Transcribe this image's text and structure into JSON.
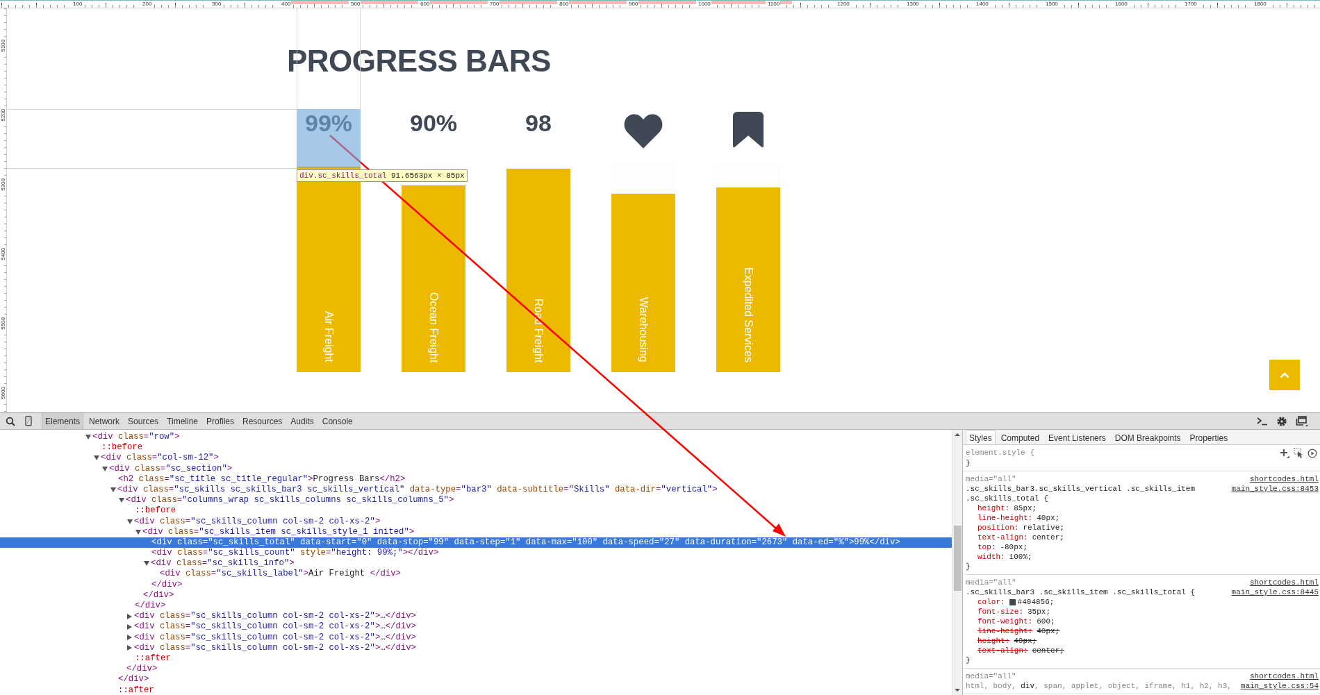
{
  "ruler": {
    "top_labels": [
      "100",
      "200",
      "300",
      "400",
      "500",
      "600",
      "700",
      "800",
      "900",
      "1000",
      "1100",
      "1200",
      "1300",
      "1400",
      "1500",
      "1600",
      "1700",
      "1800"
    ],
    "left_labels": [
      "5100",
      "5200",
      "5300",
      "5400",
      "5500",
      "5600"
    ]
  },
  "page": {
    "title": "PROGRESS BARS",
    "skills": [
      {
        "kind": "total",
        "total": "99%",
        "label": "Air Freight",
        "level": 0.99,
        "inspected": true
      },
      {
        "kind": "total",
        "total": "90%",
        "label": "Ocean Freight",
        "level": 0.9,
        "inspected": false
      },
      {
        "kind": "total",
        "total": "98",
        "label": "Road Freight",
        "level": 0.98,
        "inspected": false
      },
      {
        "kind": "heart",
        "label": "Warehousing",
        "level": 0.86,
        "inspected": false
      },
      {
        "kind": "bookmark",
        "label": "Expedited Services",
        "level": 0.89,
        "inspected": false
      }
    ],
    "inspector_tooltip": {
      "selector": "div.sc_skills_total",
      "size": "91.6563px × 85px"
    }
  },
  "devtools": {
    "tabs": [
      {
        "label": "Elements",
        "selected": true
      },
      {
        "label": "Network",
        "selected": false
      },
      {
        "label": "Sources",
        "selected": false
      },
      {
        "label": "Timeline",
        "selected": false
      },
      {
        "label": "Profiles",
        "selected": false
      },
      {
        "label": "Resources",
        "selected": false
      },
      {
        "label": "Audits",
        "selected": false
      },
      {
        "label": "Console",
        "selected": false
      }
    ],
    "elements_tree": [
      {
        "line": "<div class=\"row\">",
        "expanded": true,
        "selected": false,
        "children": [
          {
            "line": "::before",
            "selected": false
          },
          {
            "line": "<div class=\"col-sm-12\">",
            "expanded": true,
            "selected": false,
            "children": [
              {
                "line": "<div class=\"sc_section\">",
                "expanded": true,
                "selected": false,
                "children": [
                  {
                    "line": "<h2 class=\"sc_title sc_title_regular\">Progress Bars</h2>",
                    "selected": false
                  },
                  {
                    "line": "<div class=\"sc_skills sc_skills_bar3 sc_skills_vertical\" data-type=\"bar3\" data-subtitle=\"Skills\" data-dir=\"vertical\">",
                    "expanded": true,
                    "selected": false,
                    "close": "</div>",
                    "children": [
                      {
                        "line": "<div class=\"columns_wrap sc_skills_columns sc_skills_columns_5\">",
                        "expanded": true,
                        "selected": false,
                        "close": "</div>",
                        "children": [
                          {
                            "line": "::before",
                            "selected": false
                          },
                          {
                            "line": "<div class=\"sc_skills_column col-sm-2 col-xs-2\">",
                            "expanded": true,
                            "selected": false,
                            "close": "</div>",
                            "children": [
                              {
                                "line": "<div class=\"sc_skills_item sc_skills_style_1 inited\">",
                                "expanded": true,
                                "selected": false,
                                "close": "</div>",
                                "children": [
                                  {
                                    "line": "<div class=\"sc_skills_total\" data-start=\"0\" data-stop=\"99\" data-step=\"1\" data-max=\"100\" data-speed=\"27\" data-duration=\"2673\" data-ed=\"%\">99%</div>",
                                    "selected": true
                                  },
                                  {
                                    "line": "<div class=\"sc_skills_count\" style=\"height: 99%;\"></div>",
                                    "selected": false
                                  },
                                  {
                                    "line": "<div class=\"sc_skills_info\">",
                                    "expanded": true,
                                    "selected": false,
                                    "close": "</div>",
                                    "children": [
                                      {
                                        "line": "<div class=\"sc_skills_label\">Air Freight </div>",
                                        "selected": false
                                      }
                                    ]
                                  }
                                ]
                              }
                            ]
                          },
                          {
                            "line": "<div class=\"sc_skills_column col-sm-2 col-xs-2\">…</div>",
                            "expanded": false,
                            "selected": false
                          },
                          {
                            "line": "<div class=\"sc_skills_column col-sm-2 col-xs-2\">…</div>",
                            "expanded": false,
                            "selected": false
                          },
                          {
                            "line": "<div class=\"sc_skills_column col-sm-2 col-xs-2\">…</div>",
                            "expanded": false,
                            "selected": false
                          },
                          {
                            "line": "<div class=\"sc_skills_column col-sm-2 col-xs-2\">…</div>",
                            "expanded": false,
                            "selected": false
                          },
                          {
                            "line": "::after",
                            "selected": false
                          }
                        ]
                      }
                    ]
                  },
                  {
                    "line": "::after",
                    "selected": false
                  }
                ]
              }
            ]
          }
        ]
      }
    ],
    "styles_pane": {
      "tabs": [
        {
          "label": "Styles",
          "selected": true
        },
        {
          "label": "Computed",
          "selected": false
        },
        {
          "label": "Event Listeners",
          "selected": false
        },
        {
          "label": "DOM Breakpoints",
          "selected": false
        },
        {
          "label": "Properties",
          "selected": false
        }
      ],
      "rules": [
        {
          "kind": "inline",
          "selector_lines": [
            [
              {
                "text": "element.style {",
                "matched": false
              }
            ]
          ],
          "close": "}"
        },
        {
          "kind": "matched",
          "media": "media=\"all\"",
          "sources": [
            "shortcodes.html",
            "main_style.css:8453"
          ],
          "selector_lines": [
            [
              {
                "text": ".sc_skills_bar3.sc_skills_vertical .sc_skills_item",
                "matched": true
              }
            ],
            [
              {
                "text": ".sc_skills_total {",
                "matched": true
              }
            ]
          ],
          "properties": [
            {
              "name": "height:",
              "value": "85px;",
              "overridden": false
            },
            {
              "name": "line-height:",
              "value": "40px;",
              "overridden": false
            },
            {
              "name": "position:",
              "value": "relative;",
              "overridden": false
            },
            {
              "name": "text-align:",
              "value": "center;",
              "overridden": false
            },
            {
              "name": "top:",
              "value": "-80px;",
              "overridden": false
            },
            {
              "name": "width:",
              "value": "100%;",
              "overridden": false
            }
          ],
          "close": "}"
        },
        {
          "kind": "matched",
          "media": "media=\"all\"",
          "sources": [
            "shortcodes.html",
            "main_style.css:8445"
          ],
          "selector_lines": [
            [
              {
                "text": ".sc_skills_bar3 .sc_skills_item .sc_skills_total {",
                "matched": true
              }
            ]
          ],
          "properties": [
            {
              "name": "color:",
              "color": "#404856",
              "value": "#404856;",
              "overridden": false
            },
            {
              "name": "font-size:",
              "value": "35px;",
              "overridden": false
            },
            {
              "name": "font-weight:",
              "value": "600;",
              "overridden": false
            },
            {
              "name": "line-height:",
              "value": "40px;",
              "overridden": true
            },
            {
              "name": "height:",
              "value": "40px;",
              "overridden": true
            },
            {
              "name": "text-align:",
              "value": "center;",
              "overridden": true
            }
          ],
          "close": "}"
        },
        {
          "kind": "matched",
          "media": "media=\"all\"",
          "sources": [
            "shortcodes.html",
            "main_style.css:54"
          ],
          "selector_lines": [
            [
              {
                "text": "html, body, ",
                "matched": false
              },
              {
                "text": "div",
                "matched": true
              },
              {
                "text": ", span, applet, object, iframe, h1, h2, h3,",
                "matched": false
              }
            ]
          ]
        }
      ]
    }
  }
}
